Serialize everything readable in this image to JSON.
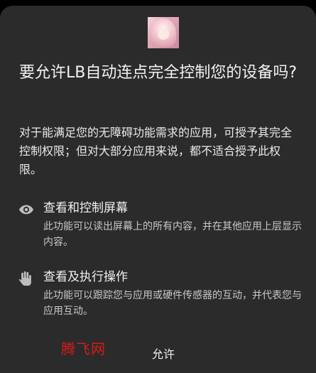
{
  "dialog": {
    "title": "要允许LB自动连点完全控制您的设备吗?",
    "description": "对于能满足您的无障碍功能需求的应用，可授予其完全控制权限；但对大部分应用来说，都不适合授予此权限。",
    "permissions": [
      {
        "icon": "eye-icon",
        "label": "查看和控制屏幕",
        "detail": "此功能可以读出屏幕上的所有内容，并在其他应用上层显示内容。"
      },
      {
        "icon": "hand-icon",
        "label": "查看及执行操作",
        "detail": "此功能可以跟踪您与应用或硬件传感器的互动，并代表您与应用互动。"
      }
    ],
    "allow_button": "允许"
  },
  "watermark": "腾飞网",
  "colors": {
    "dialog_background": "#2b2b2b",
    "text_primary": "#f2f2f2",
    "text_secondary": "#c8c8c8",
    "icon": "#bdbdbd",
    "watermark": "#d61b1b"
  }
}
